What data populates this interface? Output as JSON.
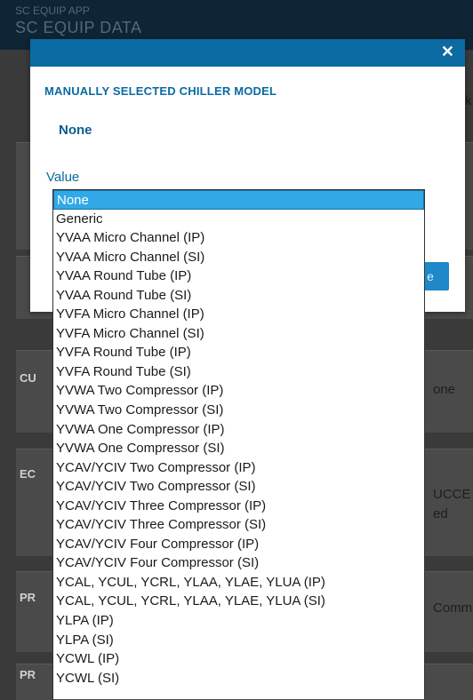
{
  "app": {
    "title_small": "SC EQUIP APP",
    "title_large": "SC EQUIP DATA"
  },
  "background": {
    "edge_labels": [
      "CU",
      "EC",
      "PR",
      "PR"
    ],
    "right_texts": [
      "k",
      "one",
      "UCCE",
      "ed",
      "Comm"
    ],
    "partial_button": "e"
  },
  "modal": {
    "title": "MANUALLY SELECTED CHILLER MODEL",
    "current_value": "None",
    "value_label": "Value",
    "close_icon": "close-icon"
  },
  "dropdown": {
    "selected": "None",
    "options": [
      "None",
      "Generic",
      "YVAA Micro Channel (IP)",
      "YVAA Micro Channel (SI)",
      "YVAA Round Tube (IP)",
      "YVAA Round Tube (SI)",
      "YVFA Micro Channel (IP)",
      "YVFA Micro Channel (SI)",
      "YVFA Round Tube (IP)",
      "YVFA Round Tube (SI)",
      "YVWA Two Compressor (IP)",
      "YVWA Two Compressor (SI)",
      "YVWA One Compressor (IP)",
      "YVWA One Compressor (SI)",
      "YCAV/YCIV Two Compressor (IP)",
      "YCAV/YCIV Two Compressor (SI)",
      "YCAV/YCIV Three Compressor (IP)",
      "YCAV/YCIV Three Compressor (SI)",
      "YCAV/YCIV Four Compressor (IP)",
      "YCAV/YCIV Four Compressor (SI)",
      "YCAL, YCUL, YCRL, YLAA, YLAE, YLUA (IP)",
      "YCAL, YCUL, YCRL, YLAA, YLAE, YLUA (SI)",
      "YLPA (IP)",
      "YLPA (SI)",
      "YCWL (IP)",
      "YCWL (SI)"
    ]
  }
}
